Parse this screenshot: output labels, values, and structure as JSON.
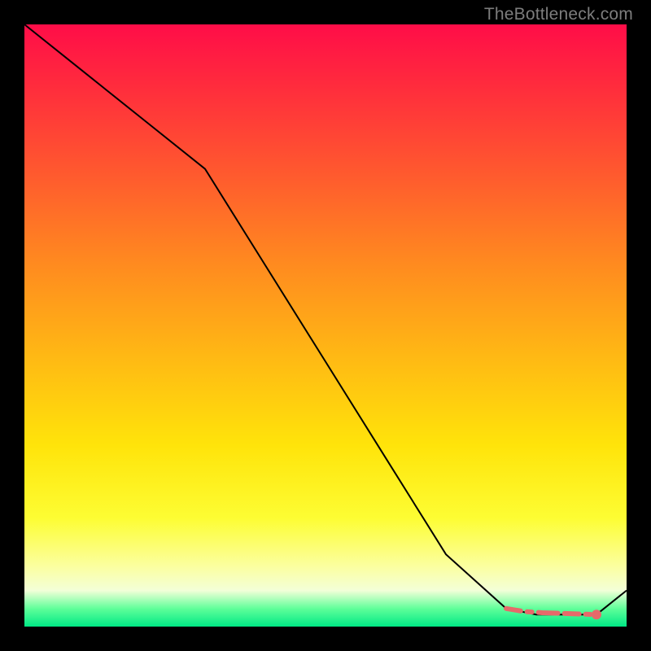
{
  "watermark": "TheBottleneck.com",
  "chart_data": {
    "type": "line",
    "title": "",
    "xlabel": "",
    "ylabel": "",
    "xlim": [
      0,
      100
    ],
    "ylim": [
      0,
      100
    ],
    "grid": false,
    "legend": false,
    "series": [
      {
        "name": "curve",
        "color": "#000000",
        "x": [
          0,
          10,
          20,
          30,
          40,
          50,
          60,
          70,
          80,
          85,
          90,
          95,
          100
        ],
        "y": [
          100,
          92,
          84,
          76,
          60,
          44,
          28,
          12,
          3,
          2,
          2,
          2,
          6
        ]
      }
    ],
    "markers": {
      "name": "highlight-segment",
      "color": "#e66a6a",
      "x": [
        80,
        83,
        86,
        89,
        92,
        95
      ],
      "y": [
        3,
        2.5,
        2.3,
        2.2,
        2.1,
        2
      ],
      "end_dot": {
        "x": 95,
        "y": 2
      }
    },
    "background_gradient": [
      {
        "pos": 0.0,
        "color": "#ff0d48"
      },
      {
        "pos": 0.4,
        "color": "#ff8b1f"
      },
      {
        "pos": 0.7,
        "color": "#ffe40a"
      },
      {
        "pos": 0.9,
        "color": "#fbffa0"
      },
      {
        "pos": 0.97,
        "color": "#60ff9a"
      },
      {
        "pos": 1.0,
        "color": "#00e885"
      }
    ]
  }
}
